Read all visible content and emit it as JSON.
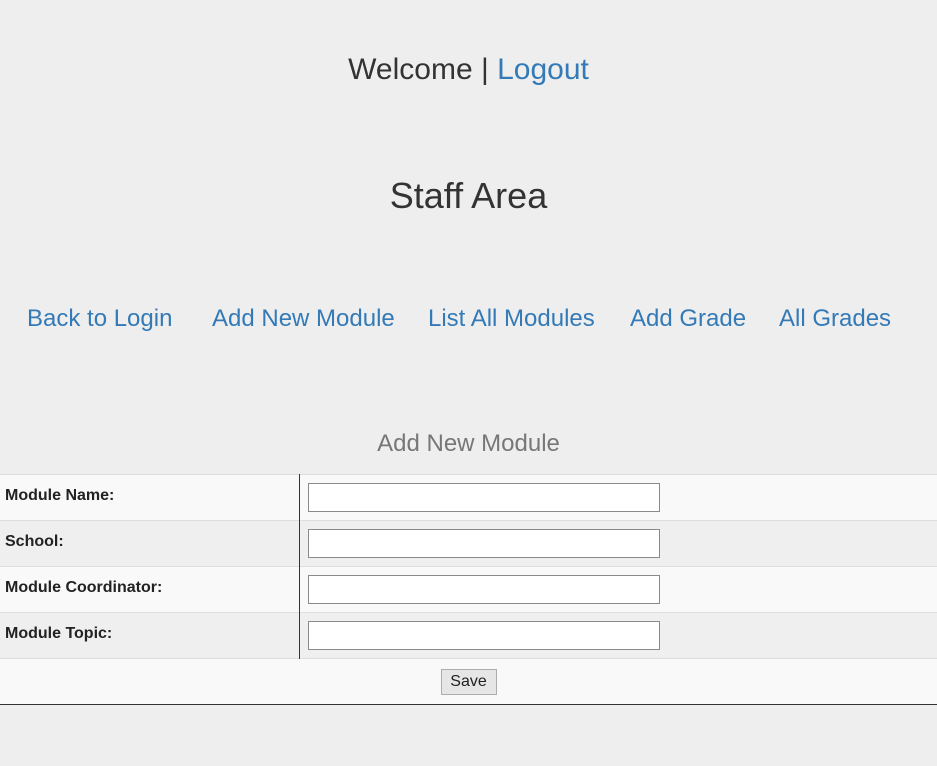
{
  "header": {
    "welcome_text": "Welcome",
    "separator": " | ",
    "logout_label": "Logout"
  },
  "page_title": "Staff Area",
  "nav": {
    "items": [
      {
        "label": "Back to Login"
      },
      {
        "label": "Add New Module"
      },
      {
        "label": "List All Modules"
      },
      {
        "label": "Add Grade"
      },
      {
        "label": "All Grades"
      }
    ]
  },
  "form": {
    "title": "Add New Module",
    "fields": [
      {
        "label": "Module Name:",
        "value": ""
      },
      {
        "label": "School:",
        "value": ""
      },
      {
        "label": "Module Coordinator:",
        "value": ""
      },
      {
        "label": "Module Topic:",
        "value": ""
      }
    ],
    "save_label": "Save"
  }
}
